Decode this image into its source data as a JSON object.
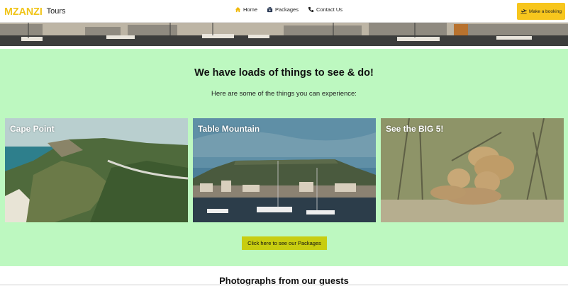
{
  "brand": {
    "mzansi": "MZANZI",
    "tours": "Tours"
  },
  "nav": {
    "items": [
      {
        "label": "Home",
        "icon": "home-icon"
      },
      {
        "label": "Packages",
        "icon": "packages-icon"
      },
      {
        "label": "Contact Us",
        "icon": "phone-icon"
      }
    ],
    "booking_label": "Make a booking",
    "booking_icon": "plane-icon"
  },
  "colors": {
    "brand_yellow": "#f0c419",
    "booking_button": "#f7c61d",
    "section_bg": "#bdf8c0",
    "cta_bg": "#c8cd10"
  },
  "main": {
    "headline": "We have loads of things to see & do!",
    "subline": "Here are some of the things you can experience:",
    "cards": [
      {
        "title": "Cape Point"
      },
      {
        "title": "Table Mountain"
      },
      {
        "title": "See the BIG 5!"
      }
    ],
    "cta_label": "Click here to see our Packages"
  },
  "photos": {
    "heading": "Photographs from our guests"
  }
}
